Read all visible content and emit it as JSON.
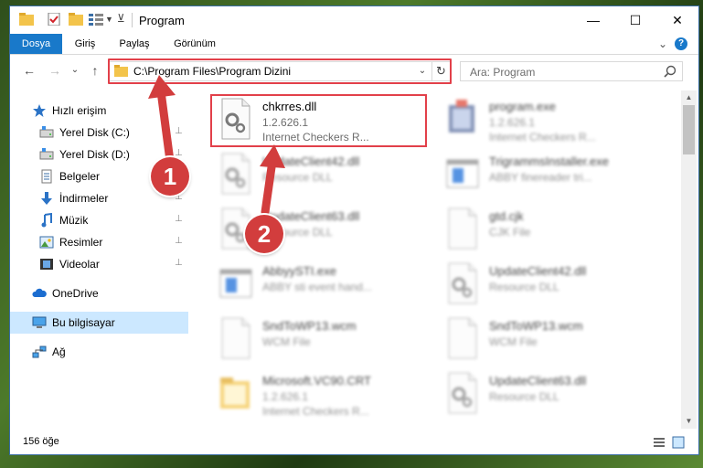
{
  "window": {
    "title": "Program",
    "controls": {
      "minimize": "—",
      "maximize": "☐",
      "close": "✕"
    }
  },
  "ribbon": {
    "tabs": [
      "Dosya",
      "Giriş",
      "Paylaş",
      "Görünüm"
    ],
    "chevron": "⌄",
    "help": "?"
  },
  "navigation": {
    "back": "←",
    "forward": "→",
    "recent": "⌄",
    "up": "↑",
    "address": "C:\\Program Files\\Program Dizini",
    "address_dropdown": "⌄",
    "refresh": "↻",
    "search_placeholder": "Ara: Program"
  },
  "sidebar": {
    "items": [
      {
        "label": "Hızlı erişim",
        "icon": "star-icon",
        "pinned": false
      },
      {
        "label": "Yerel Disk (C:)",
        "icon": "drive-icon",
        "pinned": true
      },
      {
        "label": "Yerel Disk (D:)",
        "icon": "drive-icon",
        "pinned": true
      },
      {
        "label": "Belgeler",
        "icon": "document-icon",
        "pinned": true
      },
      {
        "label": "İndirmeler",
        "icon": "download-icon",
        "pinned": true
      },
      {
        "label": "Müzik",
        "icon": "music-icon",
        "pinned": true
      },
      {
        "label": "Resimler",
        "icon": "pictures-icon",
        "pinned": true
      },
      {
        "label": "Videolar",
        "icon": "video-icon",
        "pinned": true
      },
      {
        "label": "OneDrive",
        "icon": "cloud-icon",
        "pinned": false
      },
      {
        "label": "Bu bilgisayar",
        "icon": "computer-icon",
        "pinned": false,
        "selected": true
      },
      {
        "label": "Ağ",
        "icon": "network-icon",
        "pinned": false
      }
    ],
    "pin_glyph": "📌"
  },
  "files": [
    {
      "name": "chkrres.dll",
      "line1": "1.2.626.1",
      "line2": "Internet Checkers R...",
      "type": "gear"
    },
    {
      "name": "program.exe",
      "line1": "1.2.626.1",
      "line2": "Internet Checkers R...",
      "type": "exe"
    },
    {
      "name": "UpdateClient42.dll",
      "line1": "Resource DLL",
      "line2": "",
      "type": "gear"
    },
    {
      "name": "TrigrammsInstaller.exe",
      "line1": "ABBY finereader tri...",
      "line2": "",
      "type": "window"
    },
    {
      "name": "UpdateClient63.dll",
      "line1": "Resource DLL",
      "line2": "",
      "type": "gear"
    },
    {
      "name": "gtd.cjk",
      "line1": "CJK File",
      "line2": "",
      "type": "blank"
    },
    {
      "name": "AbbyySTI.exe",
      "line1": "ABBY sti event hand...",
      "line2": "",
      "type": "window"
    },
    {
      "name": "UpdateClient42.dll",
      "line1": "Resource DLL",
      "line2": "",
      "type": "gear"
    },
    {
      "name": "SndToWP13.wcm",
      "line1": "WCM File",
      "line2": "",
      "type": "blank"
    },
    {
      "name": "SndToWP13.wcm",
      "line1": "WCM File",
      "line2": "",
      "type": "blank"
    },
    {
      "name": "Microsoft.VC90.CRT",
      "line1": "1.2.626.1",
      "line2": "Internet Checkers R...",
      "type": "folder"
    },
    {
      "name": "UpdateClient63.dll",
      "line1": "Resource DLL",
      "line2": "",
      "type": "gear"
    }
  ],
  "status": {
    "count": "156 öğe"
  },
  "markers": [
    "1",
    "2"
  ],
  "colors": {
    "accent": "#1979ca",
    "highlight": "#e2404a",
    "selected": "#cce8ff"
  }
}
